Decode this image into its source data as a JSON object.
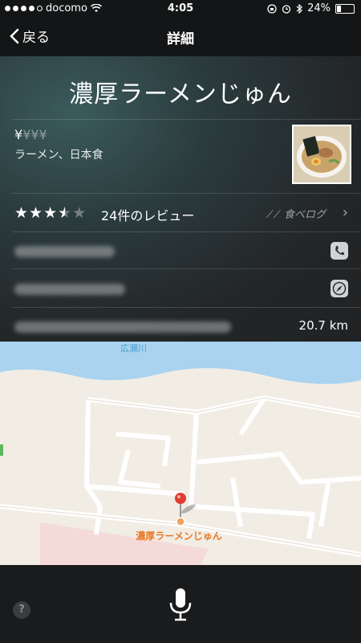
{
  "status": {
    "carrier": "docomo",
    "time": "4:05",
    "battery": "24%",
    "battery_level": 0.24
  },
  "nav": {
    "back_label": "戻る",
    "title": "詳細"
  },
  "place": {
    "name": "濃厚ラーメンじゅん",
    "price_active": "¥",
    "price_inactive": "¥¥¥",
    "categories": "ラーメン、日本食",
    "rating": 3.5,
    "stars_on": "★★★",
    "stars_half": "★",
    "stars_off": "★",
    "reviews": "24件のレビュー",
    "review_source": "食べログ",
    "distance": "20.7 km"
  },
  "map": {
    "river_label": "広瀬川",
    "pin_label": "濃厚ラーメンじゅん"
  },
  "icons": {
    "phone": "phone-icon",
    "safari": "compass-icon",
    "mic": "microphone-icon",
    "help": "?"
  },
  "colors": {
    "pin": "#e33b2e",
    "pin_label": "#e77a2a",
    "river": "#a9d3ef"
  }
}
